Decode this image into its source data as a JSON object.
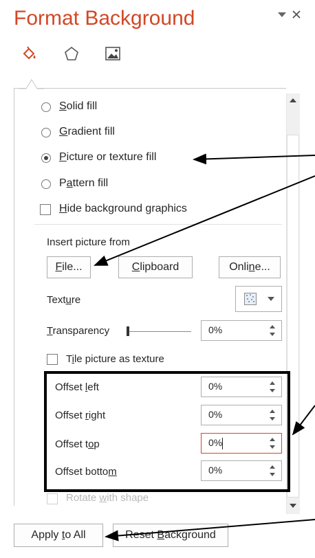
{
  "pane": {
    "title": "Format Background",
    "dropdown_icon": "triangle-down-icon",
    "close_icon": "close-icon",
    "tabs": [
      {
        "name": "fill",
        "icon": "paint-bucket-icon"
      },
      {
        "name": "effects",
        "icon": "pentagon-icon"
      },
      {
        "name": "picture",
        "icon": "picture-icon"
      }
    ]
  },
  "fill_options": {
    "solid": {
      "prefix": "",
      "key": "S",
      "rest": "olid fill",
      "checked": false
    },
    "gradient": {
      "prefix": "",
      "key": "G",
      "rest": "radient fill",
      "checked": false
    },
    "picture": {
      "prefix": "",
      "key": "P",
      "rest": "icture or texture fill",
      "checked": true
    },
    "pattern": {
      "prefix": "P",
      "key": "a",
      "rest": "ttern fill",
      "checked": false
    }
  },
  "hide_graphics": {
    "prefix": "",
    "key": "H",
    "rest": "ide background graphics",
    "checked": false
  },
  "insert_picture": {
    "label": "Insert picture from",
    "file_button": {
      "prefix": "",
      "key": "F",
      "rest": "ile..."
    },
    "clipboard_button": {
      "prefix": "",
      "key": "C",
      "rest": "lipboard"
    },
    "online_button": {
      "prefix": "Onli",
      "key": "n",
      "rest": "e..."
    }
  },
  "texture": {
    "prefix": "Text",
    "key": "u",
    "rest": "re",
    "icon": "texture-swatch-icon"
  },
  "transparency": {
    "prefix": "",
    "key": "T",
    "rest": "ransparency",
    "value": "0%",
    "level": 0
  },
  "tile": {
    "prefix": "T",
    "key": "i",
    "rest": "le picture as texture",
    "checked": false
  },
  "offsets": {
    "left": {
      "prefix": "Offset ",
      "key": "l",
      "rest": "eft",
      "value": "0%"
    },
    "right": {
      "prefix": "Offset ",
      "key": "r",
      "rest": "ight",
      "value": "0%"
    },
    "top": {
      "prefix": "Offset t",
      "key": "o",
      "rest": "p",
      "value": "0%"
    },
    "bottom": {
      "prefix": "Offset botto",
      "key": "m",
      "rest": "",
      "value": "0%"
    }
  },
  "rotate": {
    "prefix": "Rotate ",
    "key": "w",
    "rest": "ith shape",
    "checked": false,
    "disabled": true
  },
  "footer": {
    "apply_all": {
      "prefix": "Apply ",
      "key": "t",
      "rest": "o All"
    },
    "reset": {
      "prefix": "Reset ",
      "key": "B",
      "rest": "ackground"
    }
  },
  "colors": {
    "accent": "#d24726",
    "annotation": "#000000"
  }
}
